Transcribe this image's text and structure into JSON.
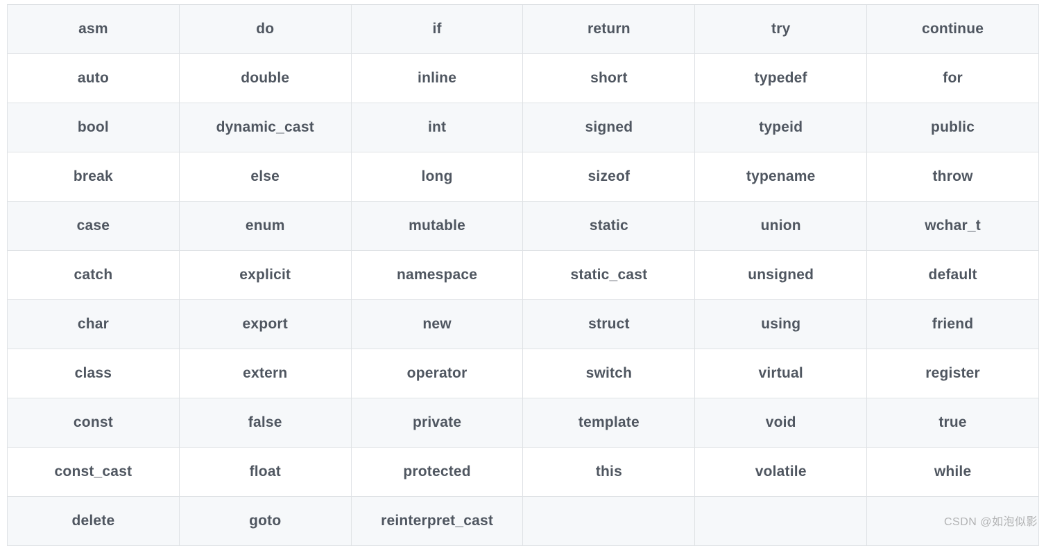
{
  "table": {
    "header": [
      "asm",
      "do",
      "if",
      "return",
      "try",
      "continue"
    ],
    "rows": [
      [
        "auto",
        "double",
        "inline",
        "short",
        "typedef",
        "for"
      ],
      [
        "bool",
        "dynamic_cast",
        "int",
        "signed",
        "typeid",
        "public"
      ],
      [
        "break",
        "else",
        "long",
        "sizeof",
        "typename",
        "throw"
      ],
      [
        "case",
        "enum",
        "mutable",
        "static",
        "union",
        "wchar_t"
      ],
      [
        "catch",
        "explicit",
        "namespace",
        "static_cast",
        "unsigned",
        "default"
      ],
      [
        "char",
        "export",
        "new",
        "struct",
        "using",
        "friend"
      ],
      [
        "class",
        "extern",
        "operator",
        "switch",
        "virtual",
        "register"
      ],
      [
        "const",
        "false",
        "private",
        "template",
        "void",
        "true"
      ],
      [
        "const_cast",
        "float",
        "protected",
        "this",
        "volatile",
        "while"
      ],
      [
        "delete",
        "goto",
        "reinterpret_cast",
        "",
        "",
        ""
      ]
    ]
  },
  "watermark": "CSDN @如泡似影"
}
